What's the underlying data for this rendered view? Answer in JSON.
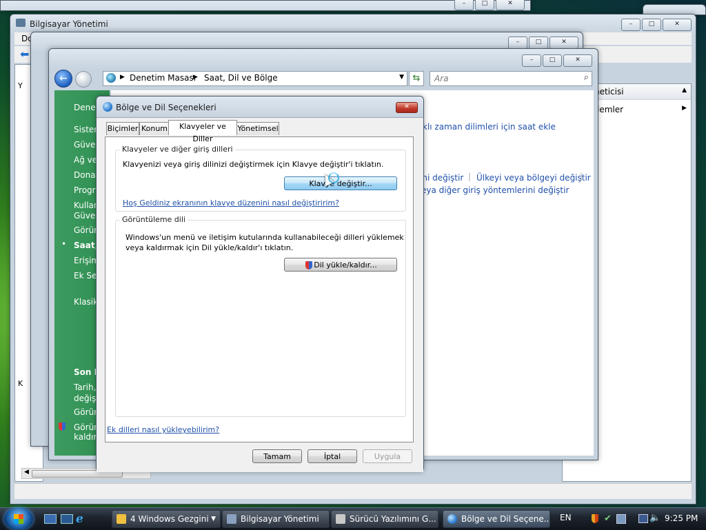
{
  "bg_window": {
    "title": "Bilgisayar Yönetimi",
    "menu_first": "Do",
    "left_tree_items": [
      "Y",
      "K"
    ]
  },
  "mid_window": {
    "right_panel": {
      "header": "neticisi",
      "item": "lemler"
    }
  },
  "control_panel": {
    "address": {
      "part1": "Denetim Masası",
      "part2": "Saat, Dil ve Bölge"
    },
    "search_placeholder": "Ara",
    "sidebar": {
      "top": "Denet",
      "items": [
        "Sister",
        "Güver",
        "Ağ ve",
        "Donar",
        "Progra",
        "Kullan",
        "Güver",
        "Görün",
        "Saat, I",
        "Erişim",
        "Ek Seç",
        "Klasik"
      ],
      "recent_title": "Son K",
      "recent_items": [
        "Tarih,",
        "değişt",
        "Görün",
        "Görün",
        "kaldır"
      ]
    },
    "right_links": {
      "row1": "klı zaman dilimleri için saat ekle",
      "row2a": "ini değiştir",
      "row2b": "Ülkeyi veya bölgeyi değiştir",
      "row3": "eya diğer giriş yöntemlerini değiştir"
    }
  },
  "dialog": {
    "title": "Bölge ve Dil Seçenekleri",
    "close": "✕",
    "tabs": [
      "Biçimler",
      "Konum",
      "Klavyeler ve Diller",
      "Yönetimsel"
    ],
    "keyboard_group": {
      "label": "Klavyeler ve diğer giriş dilleri",
      "text": "Klavyenizi veya giriş dilinizi değiştirmek için Klavye değiştir'i tıklatın.",
      "button": "Klavye değiştir...",
      "link": "Hoş Geldiniz ekranının klavye düzenini nasıl değiştiririm?"
    },
    "display_group": {
      "label": "Görüntüleme dili",
      "text_line1": "Windows'un menü ve iletişim kutularında kullanabileceği dilleri yüklemek",
      "text_line2": "veya kaldırmak için Dil yükle/kaldır'ı tıklatın.",
      "button": "Dil yükle/kaldır..."
    },
    "bottom_link": "Ek dilleri nasıl yükleyebilirim?",
    "buttons": {
      "ok": "Tamam",
      "cancel": "İptal",
      "apply": "Uygula"
    }
  },
  "taskbar": {
    "tasks": [
      "4 Windows Gezgini",
      "Bilgisayar Yönetimi",
      "Sürücü Yazılımını G...",
      "Bölge ve Dil Seçene..."
    ],
    "language": "EN",
    "time": "9:25 PM"
  },
  "colors": {
    "sidebar_green": "#2f8f52",
    "link_blue": "#1f4fa8",
    "taskbar": "#1e252e"
  }
}
